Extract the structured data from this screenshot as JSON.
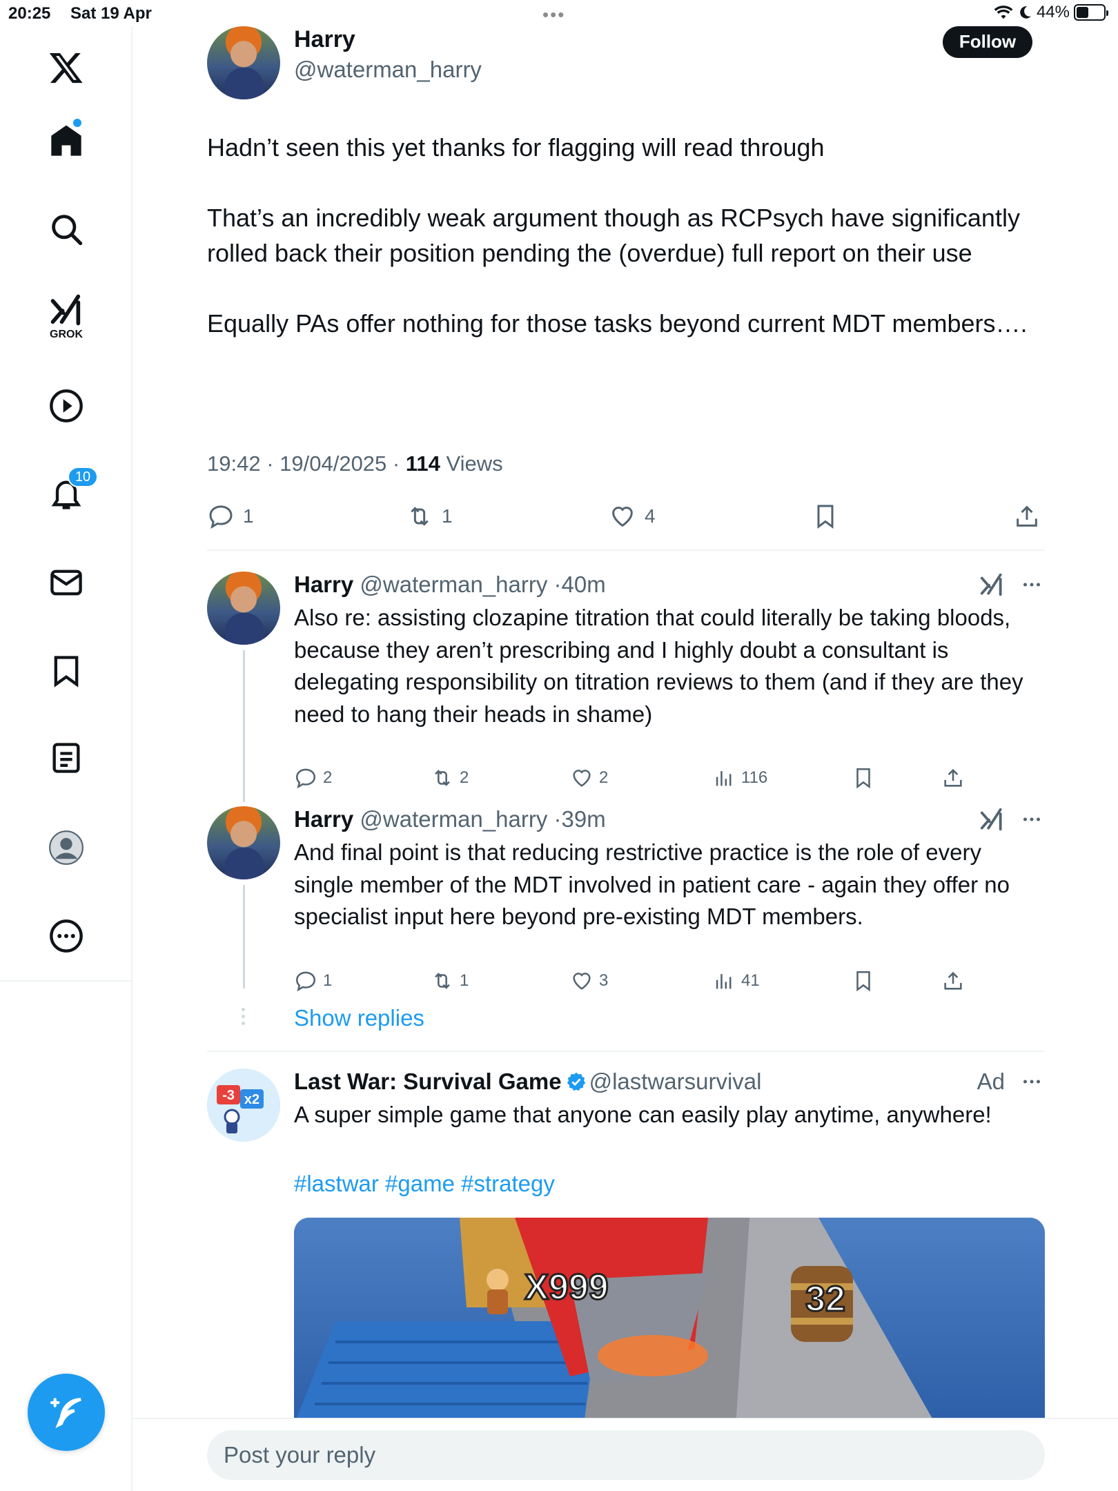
{
  "status_bar": {
    "time": "20:25",
    "date": "Sat 19 Apr",
    "battery": "44%",
    "battery_level": 0.44
  },
  "sidebar": {
    "items": [
      {
        "icon": "x-logo-icon"
      },
      {
        "icon": "home-icon",
        "has_dot": true
      },
      {
        "icon": "search-icon"
      },
      {
        "icon": "grok-icon",
        "label": "GROK"
      },
      {
        "icon": "video-play-icon"
      },
      {
        "icon": "notifications-bell-icon",
        "badge": "10"
      },
      {
        "icon": "messages-envelope-icon"
      },
      {
        "icon": "bookmarks-icon"
      },
      {
        "icon": "lists-icon"
      },
      {
        "icon": "profile-icon"
      },
      {
        "icon": "more-icon"
      }
    ],
    "compose_icon": "compose-feather-icon"
  },
  "main_tweet": {
    "name": "Harry",
    "handle": "@waterman_harry",
    "follow_label": "Follow",
    "paragraphs": [
      "Hadn’t seen this yet thanks for flagging will read through",
      "That’s an incredibly weak argument though as RCPsych have significantly rolled back their position pending the (overdue) full report on their use",
      "Equally PAs offer nothing for those tasks beyond current MDT members…."
    ],
    "time": "19:42",
    "date": "19/04/2025",
    "views_count": "114",
    "views_label": "Views",
    "replies": "1",
    "reposts": "1",
    "likes": "4"
  },
  "replies": [
    {
      "name": "Harry",
      "handle": "@waterman_harry",
      "time": "40m",
      "text": "Also re: assisting clozapine titration that could literally be taking bloods, because they aren’t prescribing and I highly doubt a consultant is delegating responsibility on titration reviews to them (and if they are they need to hang their heads in shame)",
      "replies": "2",
      "reposts": "2",
      "likes": "2",
      "views": "116"
    },
    {
      "name": "Harry",
      "handle": "@waterman_harry",
      "time": "39m",
      "text": "And final point is that reducing restrictive practice is the role of every single member of the MDT involved in patient care - again they offer no specialist input here beyond pre-existing MDT members.",
      "replies": "1",
      "reposts": "1",
      "likes": "3",
      "views": "41"
    }
  ],
  "show_replies_label": "Show replies",
  "ad": {
    "name": "Last War: Survival Game",
    "handle": "@lastwarsurvival",
    "ad_label": "Ad",
    "text": "A super simple game that anyone can easily play anytime, anywhere!",
    "hashtags": "#lastwar #game #strategy",
    "media_labels": {
      "multiplier": "X999",
      "barrel": "32"
    },
    "avatar_labels": {
      "minus": "-3",
      "times": "x2"
    }
  },
  "reply_box": {
    "placeholder": "Post your reply"
  },
  "colors": {
    "accent": "#1d9bf0",
    "text": "#0f1419",
    "secondary": "#536471",
    "border": "#eff3f4"
  }
}
